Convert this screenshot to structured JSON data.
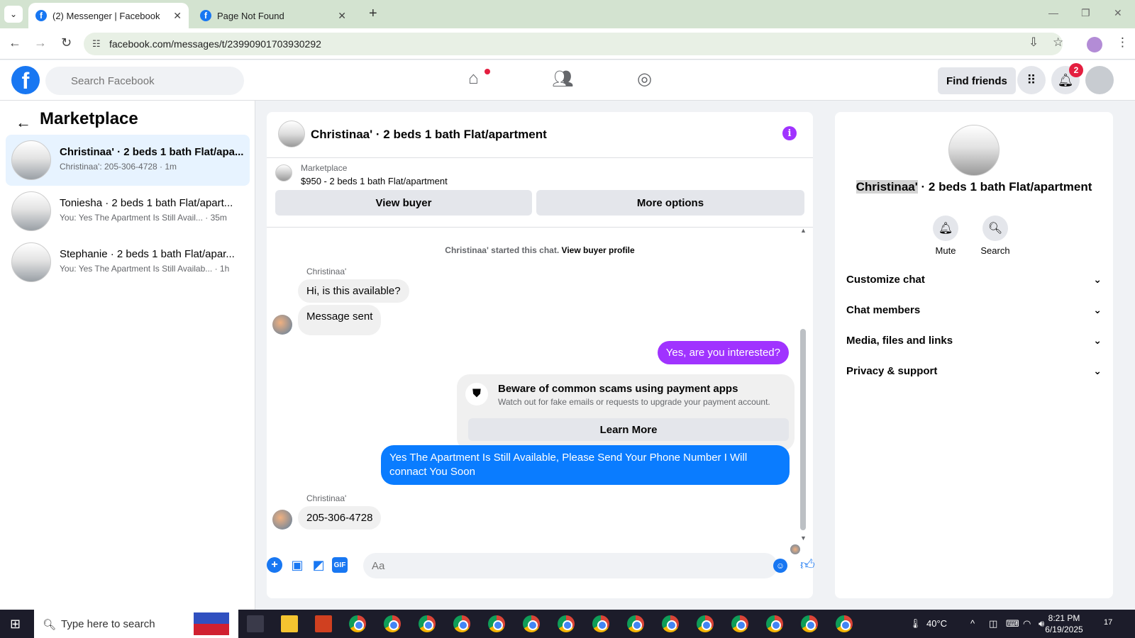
{
  "browser": {
    "tabs": [
      {
        "title": "(2) Messenger | Facebook",
        "active": true
      },
      {
        "title": "Page Not Found",
        "active": false
      }
    ],
    "url": "facebook.com/messages/t/23990901703930292"
  },
  "fb_header": {
    "search_placeholder": "Search Facebook",
    "find_friends": "Find friends",
    "notification_count": "2"
  },
  "sidebar": {
    "title": "Marketplace",
    "conversations": [
      {
        "name": "Christinaa' · 2 beds 1 bath Flat/apa...",
        "preview": "Christinaa': 205-306-4728 · 1m"
      },
      {
        "name": "Toniesha · 2 beds 1 bath Flat/apart...",
        "preview": "You: Yes The Apartment Is Still Avail... · 35m"
      },
      {
        "name": "Stephanie · 2 beds 1 bath Flat/apar...",
        "preview": "You: Yes The Apartment Is Still Availab... · 1h"
      }
    ]
  },
  "chat": {
    "title": "Christinaa' · 2 beds 1 bath Flat/apartment",
    "marketplace_label": "Marketplace",
    "listing": "$950 - 2 beds 1 bath Flat/apartment",
    "view_buyer": "View buyer",
    "more_options": "More options",
    "started_text": "Christinaa' started this chat.",
    "view_buyer_profile": "View buyer profile",
    "sender_name_1": "Christinaa'",
    "msg_1": "Hi, is this available?",
    "msg_2": "Message sent",
    "msg_out_1": "Yes, are you interested?",
    "warning_title": "Beware of common scams using payment apps",
    "warning_sub": "Watch out for fake emails or requests to upgrade your payment account.",
    "learn_more": "Learn More",
    "msg_out_2": "Yes The Apartment Is Still Available, Please Send Your Phone Number I Will connact You Soon",
    "sender_name_2": "Christinaa'",
    "msg_3": "205-306-4728",
    "composer_placeholder": "Aa",
    "composer_gif": "GIF"
  },
  "right_panel": {
    "name_highlight": "Christinaa'",
    "name_rest": " · 2 beds 1 bath Flat/apartment",
    "mute": "Mute",
    "search": "Search",
    "sections": [
      "Customize chat",
      "Chat members",
      "Media, files and links",
      "Privacy & support"
    ]
  },
  "taskbar": {
    "search_placeholder": "Type here to search",
    "temperature": "40°C",
    "time": "8:21 PM",
    "date": "6/19/2025",
    "notif_count": "17"
  },
  "colors": {
    "fb_blue": "#1877f2",
    "purple_bubble": "#a033ff",
    "blue_bubble": "#0a7cff",
    "selected_conv": "#e7f3ff"
  }
}
